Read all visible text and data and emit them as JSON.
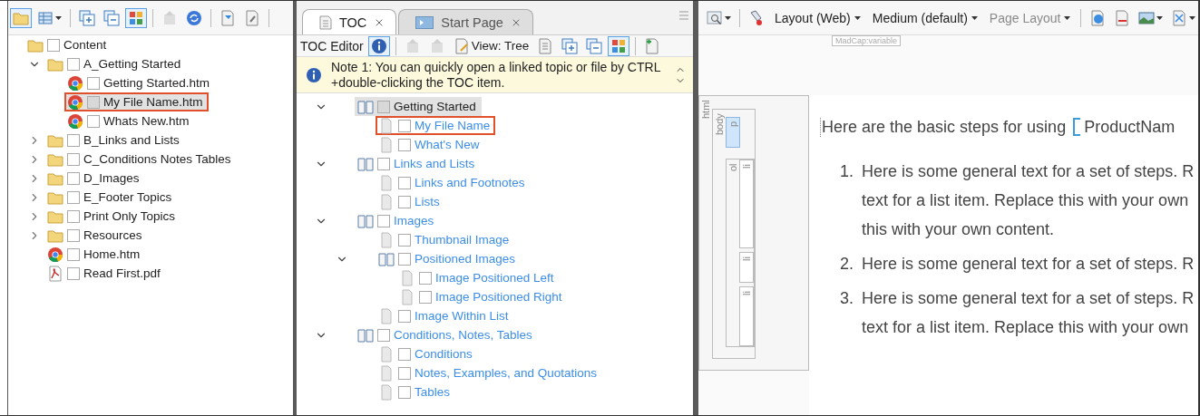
{
  "file_toolbar": [
    {
      "kind": "folder",
      "selected": true,
      "disabled": false,
      "dropdown": false
    },
    {
      "kind": "table",
      "selected": false,
      "disabled": false,
      "dropdown": true
    },
    {
      "kind": "separator"
    },
    {
      "kind": "expand",
      "selected": false,
      "disabled": false,
      "dropdown": false
    },
    {
      "kind": "collapse",
      "selected": false,
      "disabled": false,
      "dropdown": false
    },
    {
      "kind": "tiles",
      "selected": true,
      "disabled": false,
      "dropdown": false
    },
    {
      "kind": "separator"
    },
    {
      "kind": "arrow",
      "selected": false,
      "disabled": true,
      "dropdown": false
    },
    {
      "kind": "sync",
      "selected": false,
      "disabled": false,
      "dropdown": false
    },
    {
      "kind": "separator"
    },
    {
      "kind": "publish",
      "selected": false,
      "disabled": false,
      "dropdown": false
    },
    {
      "kind": "wrench",
      "selected": false,
      "disabled": false,
      "dropdown": false
    },
    {
      "kind": "separator"
    }
  ],
  "file_tree": [
    {
      "kind": "folder_open",
      "label": "Content",
      "checked": false,
      "selected": false,
      "outlined": false,
      "children": [
        {
          "kind": "folder_open",
          "label": "A_Getting Started",
          "expanded": true,
          "checked": false,
          "selected": false,
          "outlined": false,
          "children": [
            {
              "kind": "browser",
              "label": "Getting Started.htm",
              "checked": false,
              "selected": false,
              "outlined": false
            },
            {
              "kind": "browser",
              "label": "My File Name.htm",
              "checked": false,
              "selected": true,
              "outlined": true
            },
            {
              "kind": "browser",
              "label": "Whats New.htm",
              "checked": false,
              "selected": false,
              "outlined": false
            }
          ]
        },
        {
          "kind": "folder",
          "label": "B_Links and Lists",
          "expanded": false,
          "checked": false,
          "selected": false,
          "outlined": false
        },
        {
          "kind": "folder",
          "label": "C_Conditions Notes Tables",
          "expanded": false,
          "checked": false,
          "selected": false,
          "outlined": false
        },
        {
          "kind": "folder",
          "label": "D_Images",
          "expanded": false,
          "checked": false,
          "selected": false,
          "outlined": false
        },
        {
          "kind": "folder",
          "label": "E_Footer Topics",
          "expanded": false,
          "checked": false,
          "selected": false,
          "outlined": false
        },
        {
          "kind": "folder",
          "label": "Print Only Topics",
          "expanded": false,
          "checked": false,
          "selected": false,
          "outlined": false
        },
        {
          "kind": "folder",
          "label": "Resources",
          "expanded": false,
          "checked": false,
          "selected": false,
          "outlined": false
        },
        {
          "kind": "browser",
          "label": "Home.htm",
          "checked": false,
          "selected": false,
          "outlined": false
        },
        {
          "kind": "pdf",
          "label": "Read First.pdf",
          "checked": false,
          "selected": false,
          "outlined": false
        }
      ]
    }
  ],
  "editor_tabs": [
    {
      "kind": "toc",
      "label": "TOC",
      "selected": true
    },
    {
      "kind": "start",
      "label": "Start Page",
      "selected": false
    }
  ],
  "toc_toolbar": [
    {
      "kind": "label",
      "label": "TOC Editor"
    },
    {
      "kind": "info",
      "selected": true,
      "disabled": false,
      "dropdown": false
    },
    {
      "kind": "separator"
    },
    {
      "kind": "move_up",
      "selected": false,
      "disabled": true,
      "dropdown": false
    },
    {
      "kind": "move_down",
      "selected": false,
      "disabled": true,
      "dropdown": false
    },
    {
      "kind": "view",
      "label": "View: Tree",
      "selected": false,
      "disabled": false,
      "dropdown": false
    },
    {
      "kind": "list",
      "selected": false,
      "disabled": false,
      "dropdown": false
    },
    {
      "kind": "expand",
      "selected": false,
      "disabled": false,
      "dropdown": false
    },
    {
      "kind": "collapse",
      "selected": false,
      "disabled": false,
      "dropdown": false
    },
    {
      "kind": "tiles",
      "selected": true,
      "disabled": false,
      "dropdown": false
    },
    {
      "kind": "separator"
    },
    {
      "kind": "add_link",
      "selected": false,
      "disabled": false,
      "dropdown": false
    }
  ],
  "info_bar": {
    "text": "Note 1: You can quickly open a linked topic or file by CTRL +double-clicking the TOC item."
  },
  "toc_tree": [
    {
      "kind": "book",
      "label": "Getting Started",
      "expanded": true,
      "checked": false,
      "selected": true,
      "outlined": false,
      "children": [
        {
          "kind": "page",
          "label": "My File Name",
          "checked": false,
          "selected": false,
          "outlined": true
        },
        {
          "kind": "page",
          "label": "What's New",
          "checked": false,
          "selected": false,
          "outlined": false
        }
      ]
    },
    {
      "kind": "book",
      "label": "Links and Lists",
      "expanded": true,
      "checked": false,
      "selected": false,
      "outlined": false,
      "children": [
        {
          "kind": "page",
          "label": "Links and Footnotes",
          "checked": false,
          "selected": false,
          "outlined": false
        },
        {
          "kind": "page",
          "label": "Lists",
          "checked": false,
          "selected": false,
          "outlined": false
        }
      ]
    },
    {
      "kind": "book",
      "label": "Images",
      "expanded": true,
      "checked": false,
      "selected": false,
      "outlined": false,
      "children": [
        {
          "kind": "page",
          "label": "Thumbnail Image",
          "checked": false,
          "selected": false,
          "outlined": false
        },
        {
          "kind": "book",
          "label": "Positioned Images",
          "expanded": true,
          "checked": false,
          "selected": false,
          "outlined": false,
          "children": [
            {
              "kind": "page",
              "label": "Image Positioned Left",
              "checked": false,
              "selected": false,
              "outlined": false
            },
            {
              "kind": "page",
              "label": "Image Positioned Right",
              "checked": false,
              "selected": false,
              "outlined": false
            }
          ]
        },
        {
          "kind": "page",
          "label": "Image Within List",
          "checked": false,
          "selected": false,
          "outlined": false
        }
      ]
    },
    {
      "kind": "book",
      "label": "Conditions, Notes, Tables",
      "expanded": true,
      "checked": false,
      "selected": false,
      "outlined": false,
      "children": [
        {
          "kind": "page",
          "label": "Conditions",
          "checked": false,
          "selected": false,
          "outlined": false
        },
        {
          "kind": "page",
          "label": "Notes, Examples, and Quotations",
          "checked": false,
          "selected": false,
          "outlined": false
        },
        {
          "kind": "page",
          "label": "Tables",
          "checked": false,
          "selected": false,
          "outlined": false
        }
      ]
    }
  ],
  "editor_toolbar": [
    {
      "kind": "zoom",
      "selected": false,
      "disabled": false,
      "dropdown": true
    },
    {
      "kind": "separator"
    },
    {
      "kind": "brush",
      "selected": false,
      "disabled": false,
      "dropdown": false
    },
    {
      "kind": "menu",
      "label": "Layout (Web)",
      "disabled": false,
      "dropdown": true
    },
    {
      "kind": "menu",
      "label": "Medium (default)",
      "disabled": false,
      "dropdown": true
    },
    {
      "kind": "menu",
      "label": "Page Layout",
      "disabled": true,
      "dropdown": true
    },
    {
      "kind": "separator"
    },
    {
      "kind": "globe_doc",
      "selected": false,
      "disabled": false,
      "dropdown": false
    },
    {
      "kind": "compare",
      "selected": false,
      "disabled": false,
      "dropdown": false
    },
    {
      "kind": "image",
      "selected": false,
      "disabled": false,
      "dropdown": true
    },
    {
      "kind": "close_doc",
      "selected": false,
      "disabled": false,
      "dropdown": true
    }
  ],
  "variable_tag": "MadCap:variable",
  "structure_bars": [
    {
      "label": "html",
      "selected": false,
      "children": [
        {
          "label": "body",
          "selected": false,
          "children": [
            {
              "label": "p",
              "selected": true
            },
            {
              "label": "ol",
              "selected": false,
              "children": [
                {
                  "label": "li",
                  "selected": false
                },
                {
                  "label": "li",
                  "selected": false
                },
                {
                  "label": "li",
                  "selected": false
                }
              ]
            }
          ]
        }
      ]
    }
  ],
  "document": {
    "paragraph": "Here are the basic steps for using",
    "variable": "ProductNam",
    "list": [
      {
        "number": "1.",
        "lines": [
          "Here is some general text for a set of steps. R",
          "text for a list item. Replace this with your own",
          "this with your own content."
        ]
      },
      {
        "number": "2.",
        "lines": [
          "Here is some general text for a set of steps. R"
        ]
      },
      {
        "number": "3.",
        "lines": [
          "Here is some general text for a set of steps. R",
          "text for a list item. Replace this with your own"
        ]
      }
    ]
  }
}
